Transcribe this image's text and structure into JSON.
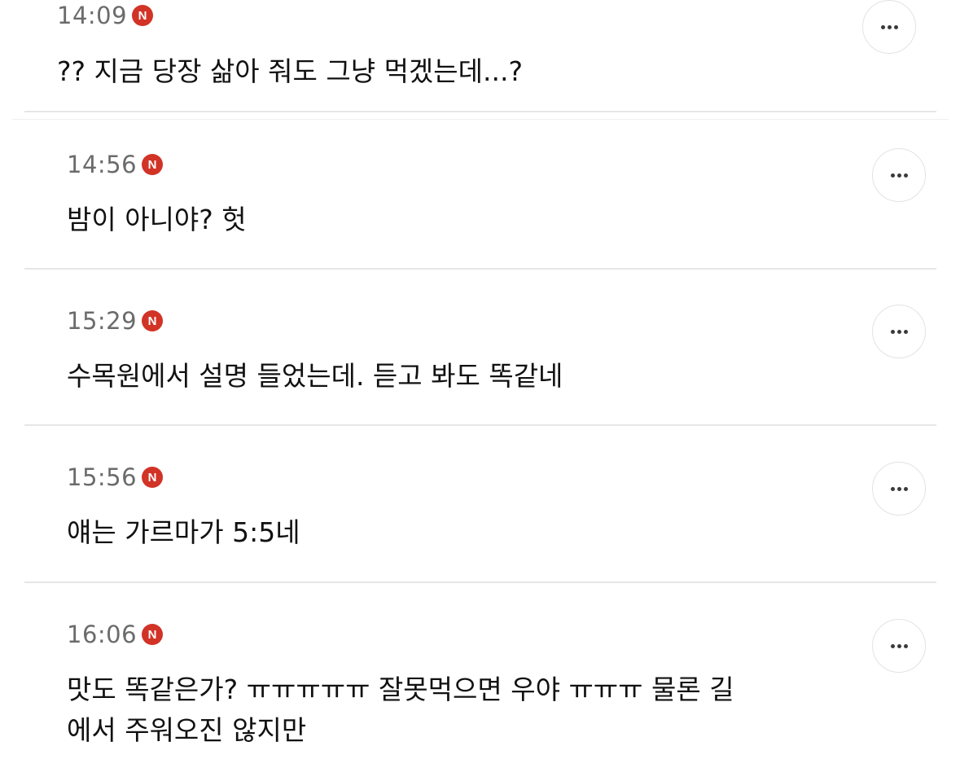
{
  "comments": [
    {
      "time": "14:09",
      "badge": "N",
      "text": "?? 지금 당장 삶아 줘도 그냥 먹겠는데...?"
    },
    {
      "time": "14:56",
      "badge": "N",
      "text": "밤이 아니야? 헛"
    },
    {
      "time": "15:29",
      "badge": "N",
      "text": "수목원에서 설명 들었는데. 듣고 봐도 똑같네"
    },
    {
      "time": "15:56",
      "badge": "N",
      "text": "얘는 가르마가 5:5네"
    },
    {
      "time": "16:06",
      "badge": "N",
      "text_line1": "맛도 똑같은가? ㅠㅠㅠㅠㅠ 잘못먹으면 우야 ㅠㅠㅠ 물론 길",
      "text_line2": "에서 주워오진 않지만"
    }
  ],
  "colors": {
    "badge": "#d13326",
    "time": "#6b6b6b",
    "text": "#111111",
    "divider": "#e6e6e6"
  },
  "icons": {
    "badge": "new-badge-icon",
    "more": "more-options-icon"
  }
}
